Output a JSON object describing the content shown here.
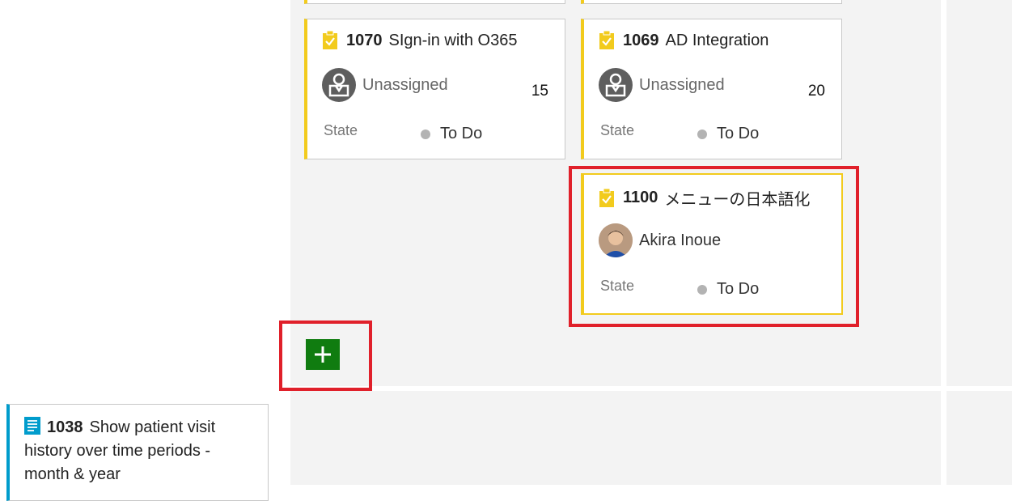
{
  "cards": {
    "c1070": {
      "id": "1070",
      "title": "SIgn-in with O365",
      "assignee": "Unassigned",
      "effort": "15",
      "state_label": "State",
      "state": "To Do"
    },
    "c1069": {
      "id": "1069",
      "title": "AD Integration",
      "assignee": "Unassigned",
      "effort": "20",
      "state_label": "State",
      "state": "To Do"
    },
    "c1100": {
      "id": "1100",
      "title": "メニューの日本語化",
      "assignee": "Akira Inoue",
      "state_label": "State",
      "state": "To Do"
    }
  },
  "story": {
    "id": "1038",
    "title": "Show patient visit history over time periods - month & year"
  },
  "colors": {
    "task_accent": "#f2cb1d",
    "story_accent": "#009ccc",
    "add_button": "#107c10",
    "highlight": "#e0202a",
    "state_dot": "#b3b3b3"
  },
  "icons": {
    "task": "task-clipboard-icon",
    "story": "user-story-icon",
    "unassigned": "unassigned-avatar-icon",
    "add": "plus-icon"
  }
}
